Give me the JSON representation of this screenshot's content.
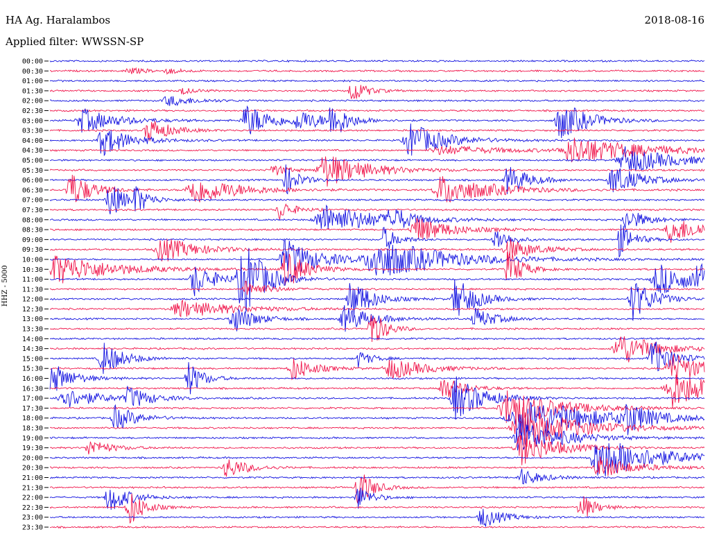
{
  "header": {
    "station": "HA Ag. Haralambos",
    "date": "2018-08-16",
    "filter": "Applied filter: WWSSN-SP"
  },
  "colors": {
    "blue": "#1010e0",
    "red": "#f0144a"
  },
  "chart_data": {
    "type": "line",
    "ylabel": "HHZ - 5000",
    "row_labels": [
      "00:00",
      "00:30",
      "01:00",
      "01:30",
      "02:00",
      "02:30",
      "03:00",
      "03:30",
      "04:00",
      "04:30",
      "05:00",
      "05:30",
      "06:00",
      "06:30",
      "07:00",
      "07:30",
      "08:00",
      "08:30",
      "09:00",
      "09:30",
      "10:00",
      "10:30",
      "11:00",
      "11:30",
      "12:00",
      "12:30",
      "13:00",
      "13:30",
      "14:00",
      "14:30",
      "15:00",
      "15:30",
      "16:00",
      "16:30",
      "17:00",
      "17:30",
      "18:00",
      "18:30",
      "19:00",
      "19:30",
      "20:00",
      "20:30",
      "21:00",
      "21:30",
      "22:00",
      "22:30",
      "23:00",
      "23:30"
    ],
    "row_colors": [
      "blue",
      "red"
    ],
    "row_duration_min": 30,
    "events": [
      {
        "row": 1,
        "t": 0.12,
        "a": 0.15,
        "w": 0.03
      },
      {
        "row": 1,
        "t": 0.18,
        "a": 0.12,
        "w": 0.02
      },
      {
        "row": 3,
        "t": 0.46,
        "a": 0.6,
        "w": 0.02
      },
      {
        "row": 3,
        "t": 0.2,
        "a": 0.18,
        "w": 0.02
      },
      {
        "row": 4,
        "t": 0.18,
        "a": 0.25,
        "w": 0.04
      },
      {
        "row": 6,
        "t": 0.05,
        "a": 0.55,
        "w": 0.05
      },
      {
        "row": 6,
        "t": 0.3,
        "a": 0.75,
        "w": 0.04
      },
      {
        "row": 6,
        "t": 0.43,
        "a": 0.9,
        "w": 0.02
      },
      {
        "row": 6,
        "t": 0.78,
        "a": 0.9,
        "w": 0.04
      },
      {
        "row": 6,
        "t": 0.38,
        "a": 0.4,
        "w": 0.04
      },
      {
        "row": 7,
        "t": 0.15,
        "a": 0.6,
        "w": 0.03
      },
      {
        "row": 8,
        "t": 0.08,
        "a": 0.7,
        "w": 0.04
      },
      {
        "row": 8,
        "t": 0.55,
        "a": 0.8,
        "w": 0.05
      },
      {
        "row": 9,
        "t": 0.8,
        "a": 0.6,
        "w": 0.1
      },
      {
        "row": 9,
        "t": 0.6,
        "a": 0.2,
        "w": 0.1
      },
      {
        "row": 10,
        "t": 0.88,
        "a": 0.6,
        "w": 0.07
      },
      {
        "row": 11,
        "t": 0.42,
        "a": 0.8,
        "w": 0.06
      },
      {
        "row": 11,
        "t": 0.34,
        "a": 0.3,
        "w": 0.02
      },
      {
        "row": 12,
        "t": 0.36,
        "a": 0.7,
        "w": 0.02
      },
      {
        "row": 12,
        "t": 0.7,
        "a": 0.7,
        "w": 0.03
      },
      {
        "row": 12,
        "t": 0.86,
        "a": 0.7,
        "w": 0.04
      },
      {
        "row": 13,
        "t": 0.03,
        "a": 0.9,
        "w": 0.03
      },
      {
        "row": 13,
        "t": 0.22,
        "a": 0.7,
        "w": 0.06
      },
      {
        "row": 13,
        "t": 0.6,
        "a": 0.7,
        "w": 0.07
      },
      {
        "row": 14,
        "t": 0.09,
        "a": 1.0,
        "w": 0.02
      },
      {
        "row": 14,
        "t": 0.13,
        "a": 0.6,
        "w": 0.02
      },
      {
        "row": 15,
        "t": 0.35,
        "a": 0.5,
        "w": 0.02
      },
      {
        "row": 16,
        "t": 0.42,
        "a": 0.7,
        "w": 0.08
      },
      {
        "row": 16,
        "t": 0.52,
        "a": 0.6,
        "w": 0.02
      },
      {
        "row": 16,
        "t": 0.88,
        "a": 0.5,
        "w": 0.03
      },
      {
        "row": 17,
        "t": 0.56,
        "a": 0.6,
        "w": 0.05
      },
      {
        "row": 17,
        "t": 0.95,
        "a": 0.6,
        "w": 0.05
      },
      {
        "row": 18,
        "t": 0.51,
        "a": 0.6,
        "w": 0.02
      },
      {
        "row": 18,
        "t": 0.68,
        "a": 0.6,
        "w": 0.02
      },
      {
        "row": 18,
        "t": 0.87,
        "a": 0.8,
        "w": 0.02
      },
      {
        "row": 19,
        "t": 0.17,
        "a": 0.6,
        "w": 0.05
      },
      {
        "row": 19,
        "t": 0.7,
        "a": 0.5,
        "w": 0.04
      },
      {
        "row": 20,
        "t": 0.36,
        "a": 0.9,
        "w": 0.05
      },
      {
        "row": 20,
        "t": 0.5,
        "a": 0.9,
        "w": 0.1
      },
      {
        "row": 21,
        "t": 0.01,
        "a": 0.7,
        "w": 0.08
      },
      {
        "row": 21,
        "t": 0.36,
        "a": 0.9,
        "w": 0.03
      },
      {
        "row": 21,
        "t": 0.7,
        "a": 1.0,
        "w": 0.02
      },
      {
        "row": 22,
        "t": 0.22,
        "a": 0.8,
        "w": 0.03
      },
      {
        "row": 22,
        "t": 0.29,
        "a": 1.0,
        "w": 0.03
      },
      {
        "row": 22,
        "t": 0.3,
        "a": 0.9,
        "w": 0.03
      },
      {
        "row": 22,
        "t": 0.93,
        "a": 0.7,
        "w": 0.06
      },
      {
        "row": 22,
        "t": 0.99,
        "a": 1.0,
        "w": 0.02
      },
      {
        "row": 23,
        "t": 0.3,
        "a": 0.4,
        "w": 0.03
      },
      {
        "row": 24,
        "t": 0.46,
        "a": 1.0,
        "w": 0.03
      },
      {
        "row": 24,
        "t": 0.62,
        "a": 1.0,
        "w": 0.03
      },
      {
        "row": 24,
        "t": 0.89,
        "a": 1.0,
        "w": 0.03
      },
      {
        "row": 25,
        "t": 0.2,
        "a": 0.4,
        "w": 0.08
      },
      {
        "row": 26,
        "t": 0.28,
        "a": 0.7,
        "w": 0.03
      },
      {
        "row": 26,
        "t": 0.45,
        "a": 0.6,
        "w": 0.04
      },
      {
        "row": 26,
        "t": 0.65,
        "a": 0.5,
        "w": 0.03
      },
      {
        "row": 27,
        "t": 0.49,
        "a": 1.0,
        "w": 0.02
      },
      {
        "row": 29,
        "t": 0.87,
        "a": 0.8,
        "w": 0.05
      },
      {
        "row": 30,
        "t": 0.08,
        "a": 0.8,
        "w": 0.03
      },
      {
        "row": 30,
        "t": 0.47,
        "a": 0.4,
        "w": 0.02
      },
      {
        "row": 30,
        "t": 0.92,
        "a": 0.9,
        "w": 0.03
      },
      {
        "row": 31,
        "t": 0.37,
        "a": 0.6,
        "w": 0.03
      },
      {
        "row": 31,
        "t": 0.52,
        "a": 0.5,
        "w": 0.05
      },
      {
        "row": 31,
        "t": 0.95,
        "a": 0.7,
        "w": 0.05
      },
      {
        "row": 32,
        "t": 0.0,
        "a": 0.8,
        "w": 0.03
      },
      {
        "row": 32,
        "t": 0.21,
        "a": 0.9,
        "w": 0.02
      },
      {
        "row": 33,
        "t": 0.95,
        "a": 0.9,
        "w": 0.06
      },
      {
        "row": 33,
        "t": 0.6,
        "a": 0.6,
        "w": 0.03
      },
      {
        "row": 34,
        "t": 0.62,
        "a": 1.0,
        "w": 0.04
      },
      {
        "row": 34,
        "t": 0.02,
        "a": 0.5,
        "w": 0.05
      },
      {
        "row": 34,
        "t": 0.12,
        "a": 0.5,
        "w": 0.03
      },
      {
        "row": 35,
        "t": 0.7,
        "a": 0.9,
        "w": 0.07
      },
      {
        "row": 36,
        "t": 0.1,
        "a": 0.6,
        "w": 0.03
      },
      {
        "row": 36,
        "t": 0.72,
        "a": 1.0,
        "w": 0.1
      },
      {
        "row": 36,
        "t": 0.88,
        "a": 0.7,
        "w": 0.03
      },
      {
        "row": 37,
        "t": 0.72,
        "a": 1.0,
        "w": 0.08
      },
      {
        "row": 38,
        "t": 0.72,
        "a": 0.8,
        "w": 0.06
      },
      {
        "row": 39,
        "t": 0.72,
        "a": 0.8,
        "w": 0.05
      },
      {
        "row": 39,
        "t": 0.06,
        "a": 0.4,
        "w": 0.03
      },
      {
        "row": 40,
        "t": 0.84,
        "a": 1.0,
        "w": 0.08
      },
      {
        "row": 41,
        "t": 0.27,
        "a": 0.5,
        "w": 0.03
      },
      {
        "row": 41,
        "t": 0.84,
        "a": 0.5,
        "w": 0.05
      },
      {
        "row": 42,
        "t": 0.72,
        "a": 0.4,
        "w": 0.03
      },
      {
        "row": 43,
        "t": 0.47,
        "a": 1.0,
        "w": 0.02
      },
      {
        "row": 44,
        "t": 0.09,
        "a": 0.7,
        "w": 0.03
      },
      {
        "row": 44,
        "t": 0.47,
        "a": 0.6,
        "w": 0.02
      },
      {
        "row": 45,
        "t": 0.12,
        "a": 1.0,
        "w": 0.02
      },
      {
        "row": 45,
        "t": 0.81,
        "a": 0.7,
        "w": 0.02
      },
      {
        "row": 46,
        "t": 0.66,
        "a": 0.5,
        "w": 0.03
      }
    ]
  }
}
